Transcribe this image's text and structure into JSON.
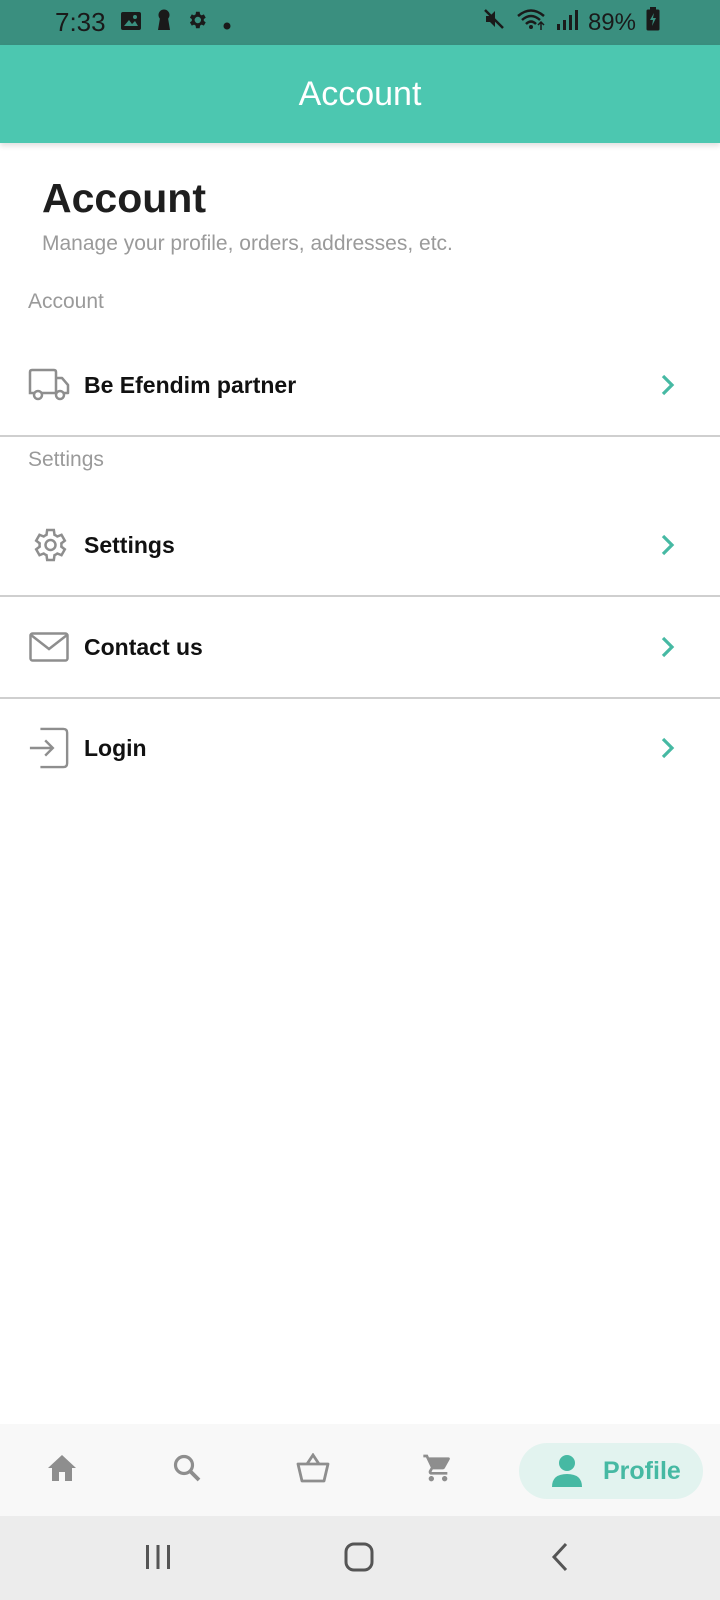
{
  "status_bar": {
    "time": "7:33",
    "battery": "89%",
    "icons": [
      "image-icon",
      "keyhole-icon",
      "gear-icon",
      "dot-icon",
      "mute-icon",
      "wifi-icon",
      "signal-icon",
      "battery-charging-icon"
    ]
  },
  "app_bar": {
    "title": "Account"
  },
  "header": {
    "title": "Account",
    "subtitle": "Manage your profile, orders, addresses, etc."
  },
  "sections": {
    "account_label": "Account",
    "settings_label": "Settings"
  },
  "rows": {
    "partner": {
      "label": "Be Efendim partner",
      "icon": "truck-icon"
    },
    "settings": {
      "label": "Settings",
      "icon": "gear-icon"
    },
    "contact": {
      "label": "Contact us",
      "icon": "envelope-icon"
    },
    "login": {
      "label": "Login",
      "icon": "login-icon"
    }
  },
  "bottom_nav": {
    "items": [
      "home-icon",
      "search-icon",
      "basket-icon",
      "cart-icon"
    ],
    "active_label": "Profile"
  },
  "colors": {
    "status_bar": "#3a8f7f",
    "accent": "#4cc7b0",
    "accent_dark": "#46b9a3",
    "active_pill": "#e2f3ef",
    "icon_gray": "#8e8e8e"
  }
}
